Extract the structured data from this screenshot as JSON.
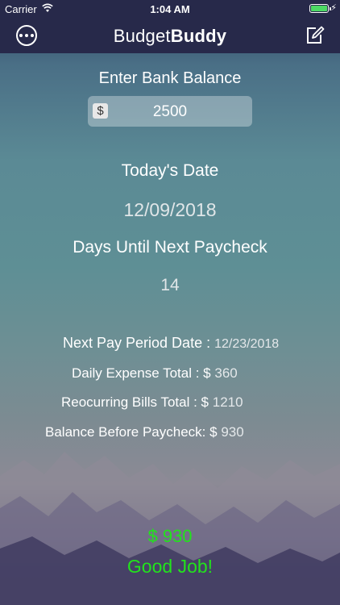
{
  "status_bar": {
    "carrier": "Carrier",
    "time": "1:04 AM",
    "wifi_icon": "wifi-icon",
    "battery_icon": "battery-full-icon",
    "battery_level": 1.0,
    "charging_icon": "bolt-icon"
  },
  "navbar": {
    "title_regular": "Budget",
    "title_bold": "Buddy",
    "menu_icon": "ellipsis-circle-icon",
    "compose_icon": "compose-icon"
  },
  "balance": {
    "label": "Enter Bank Balance",
    "currency_symbol": "$",
    "value": "2500"
  },
  "date": {
    "label": "Today's Date",
    "value": "12/09/2018"
  },
  "paycheck": {
    "label": "Days Until Next Paycheck",
    "value": "14"
  },
  "summary": {
    "next_pay_label": "Next Pay Period Date :",
    "next_pay_value": "12/23/2018",
    "daily_label": "Daily Expense Total : $",
    "daily_value": "360",
    "bills_label": "Reocurring Bills Total : $",
    "bills_value": "1210",
    "before_label": "Balance Before Paycheck: $",
    "before_value": "930"
  },
  "result": {
    "amount": "$ 930",
    "message": "Good Job!",
    "color": "#22e31c"
  },
  "colors": {
    "navbar": "#27294a",
    "battery": "#4cd964"
  }
}
